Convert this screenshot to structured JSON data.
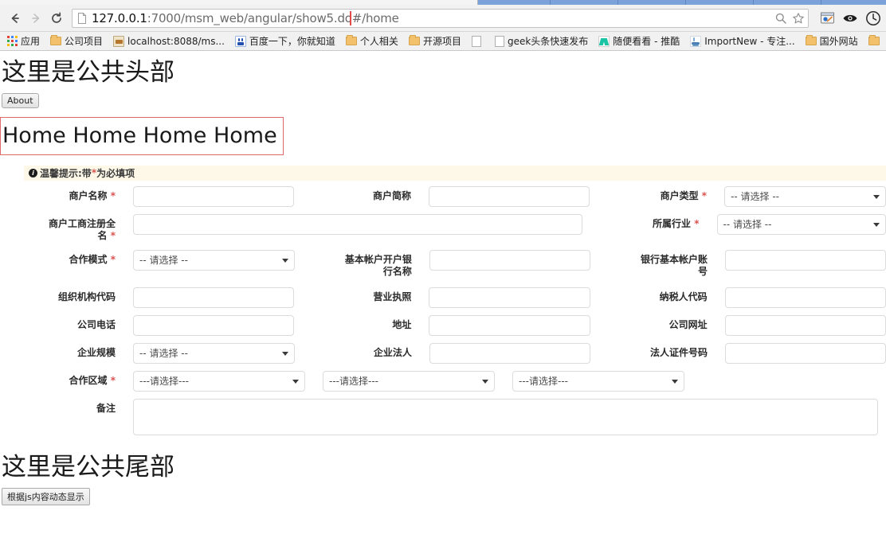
{
  "browser": {
    "back_icon": "back-arrow-icon",
    "forward_icon": "forward-arrow-icon",
    "reload_icon": "reload-icon",
    "url_full": "127.0.0.1:7000/msm_web/angular/show5.do#/home",
    "url_host": "127.0.0.1",
    "url_path": ":7000/msm_web/angular/show5.do",
    "url_hash": "#/home",
    "zoom_icon": "search-zoom-icon",
    "bookmark_star_icon": "star-icon",
    "extension_icon": "extension-icon",
    "eye_icon": "eye-icon",
    "clock_icon": "clock-icon",
    "highlight_color": "#e24b4b"
  },
  "bookmarks": [
    {
      "label": "应用",
      "icon": "apps-grid-icon"
    },
    {
      "label": "公司项目",
      "icon": "folder-icon"
    },
    {
      "label": "localhost:8088/ms...",
      "icon": "site-favicon"
    },
    {
      "label": "百度一下，你就知道",
      "icon": "baidu-favicon"
    },
    {
      "label": "个人相关",
      "icon": "folder-icon"
    },
    {
      "label": "开源项目",
      "icon": "folder-icon"
    },
    {
      "label": "",
      "icon": "page-favicon"
    },
    {
      "label": "geek头条快速发布",
      "icon": "page-favicon"
    },
    {
      "label": "随便看看 - 推酷",
      "icon": "tuicool-favicon"
    },
    {
      "label": "ImportNew - 专注...",
      "icon": "java-favicon"
    },
    {
      "label": "国外网站",
      "icon": "folder-icon"
    },
    {
      "label": "",
      "icon": "folder-icon"
    }
  ],
  "page": {
    "header_title": "这里是公共头部",
    "about_button": "About",
    "home_text": "Home Home Home Home",
    "footer_title": "这里是公共尾部",
    "footer_button": "根据js内容动态显示",
    "home_box_border_color": "#e06a6a"
  },
  "tip": {
    "icon": "info-circle-icon",
    "text_before": "温馨提示:带",
    "star": "*",
    "text_after": "为必填项",
    "background": "#fdf8e8"
  },
  "form": {
    "select_placeholder": "-- 请选择 --",
    "region_placeholder": "---请选择---",
    "rows": [
      {
        "c1": {
          "label": "商户名称",
          "required": true,
          "type": "input",
          "value": ""
        },
        "c2": {
          "label": "商户简称",
          "required": false,
          "type": "input",
          "value": ""
        },
        "c3": {
          "label": "商户类型",
          "required": true,
          "type": "select",
          "value": "-- 请选择 --"
        }
      },
      {
        "c1": {
          "label": "商户工商注册全名",
          "required": true,
          "type": "input-wide",
          "value": ""
        },
        "c3": {
          "label": "所属行业",
          "required": true,
          "type": "select",
          "value": "-- 请选择 --"
        }
      },
      {
        "c1": {
          "label": "合作模式",
          "required": true,
          "type": "select",
          "value": "-- 请选择 --"
        },
        "c2": {
          "label": "基本帐户开户银行名称",
          "required": false,
          "type": "input",
          "value": ""
        },
        "c3": {
          "label": "银行基本帐户账号",
          "required": false,
          "type": "input",
          "value": ""
        }
      },
      {
        "c1": {
          "label": "组织机构代码",
          "required": false,
          "type": "input",
          "value": ""
        },
        "c2": {
          "label": "营业执照",
          "required": false,
          "type": "input",
          "value": ""
        },
        "c3": {
          "label": "纳税人代码",
          "required": false,
          "type": "input",
          "value": ""
        }
      },
      {
        "c1": {
          "label": "公司电话",
          "required": false,
          "type": "input",
          "value": ""
        },
        "c2": {
          "label": "地址",
          "required": false,
          "type": "input",
          "value": ""
        },
        "c3": {
          "label": "公司网址",
          "required": false,
          "type": "input",
          "value": ""
        }
      },
      {
        "c1": {
          "label": "企业规模",
          "required": false,
          "type": "select",
          "value": "-- 请选择 --"
        },
        "c2": {
          "label": "企业法人",
          "required": false,
          "type": "input",
          "value": ""
        },
        "c3": {
          "label": "法人证件号码",
          "required": false,
          "type": "input",
          "value": ""
        }
      }
    ],
    "region_row": {
      "label": "合作区域",
      "required": true,
      "selects": [
        "---请选择---",
        "---请选择---",
        "---请选择---"
      ]
    },
    "memo_row": {
      "label": "备注",
      "required": false,
      "value": ""
    }
  }
}
